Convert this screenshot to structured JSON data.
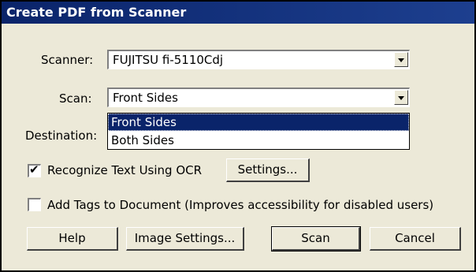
{
  "window": {
    "title": "Create PDF from Scanner"
  },
  "scanner": {
    "label": "Scanner:",
    "value": "FUJITSU fi-5110Cdj"
  },
  "scan": {
    "label": "Scan:",
    "value": "Front Sides",
    "options": [
      "Front Sides",
      "Both Sides"
    ],
    "highlighted": "Front Sides"
  },
  "destination": {
    "label": "Destination:"
  },
  "ocr": {
    "label": "Recognize Text Using OCR",
    "checked": true,
    "check_glyph": "✔",
    "settings_label": "Settings..."
  },
  "tags": {
    "label": "Add Tags to Document (Improves accessibility for disabled users)",
    "checked": false
  },
  "buttons": {
    "help": "Help",
    "image_settings": "Image Settings...",
    "scan": "Scan",
    "cancel": "Cancel"
  },
  "colors": {
    "titlebar": "#0a246a",
    "dialog_bg": "#ece9d8",
    "selection": "#0a246a"
  }
}
